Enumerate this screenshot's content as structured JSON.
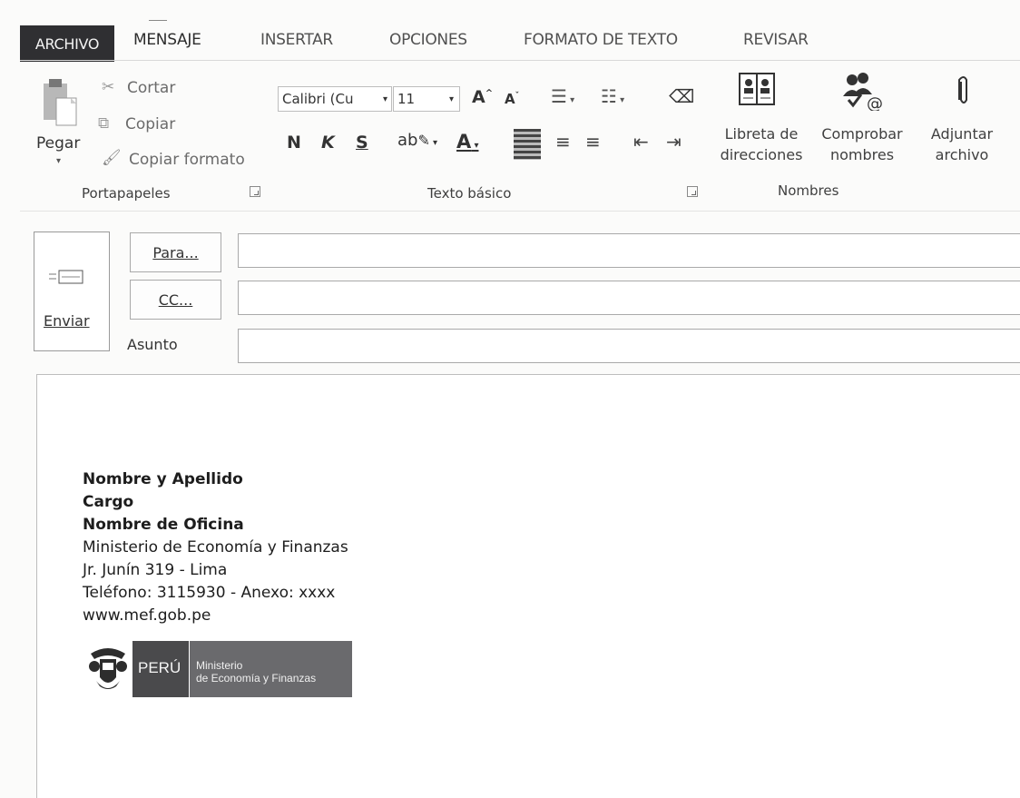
{
  "tabs": {
    "file": "ARCHIVO",
    "message": "MENSAJE",
    "insert": "INSERTAR",
    "options": "OPCIONES",
    "format_text": "FORMATO DE TEXTO",
    "review": "REVISAR"
  },
  "clipboard": {
    "paste": "Pegar",
    "cut": "Cortar",
    "copy": "Copiar",
    "format_painter": "Copiar formato",
    "group_label": "Portapapeles"
  },
  "basic_text": {
    "font_name": "Calibri (Cu",
    "font_size": "11",
    "bold": "N",
    "italic": "K",
    "underline": "S",
    "group_label": "Texto básico"
  },
  "names": {
    "address_book_line1": "Libreta de",
    "address_book_line2": "direcciones",
    "check_names_line1": "Comprobar",
    "check_names_line2": "nombres",
    "attach_line1": "Adjuntar",
    "attach_line2": "archivo",
    "group_label": "Nombres"
  },
  "compose": {
    "send": "Enviar",
    "to_button": "Para...",
    "cc_button": "CC...",
    "subject_label": "Asunto",
    "to_value": "",
    "cc_value": "",
    "subject_value": ""
  },
  "signature": {
    "name": "Nombre y Apellido",
    "position": "Cargo",
    "office": "Nombre de Oficina",
    "ministry": "Ministerio de Economía y Finanzas",
    "address": "Jr. Junín 319 - Lima",
    "phone": "Teléfono: 3115930 - Anexo: xxxx",
    "website": "www.mef.gob.pe",
    "logo_country": "PERÚ",
    "logo_line1": "Ministerio",
    "logo_line2": "de Economía y Finanzas"
  },
  "colors": {
    "file_tab_bg": "#2f2f32",
    "logo_dark": "#4a4a4c",
    "logo_gray": "#6a6a6d"
  }
}
